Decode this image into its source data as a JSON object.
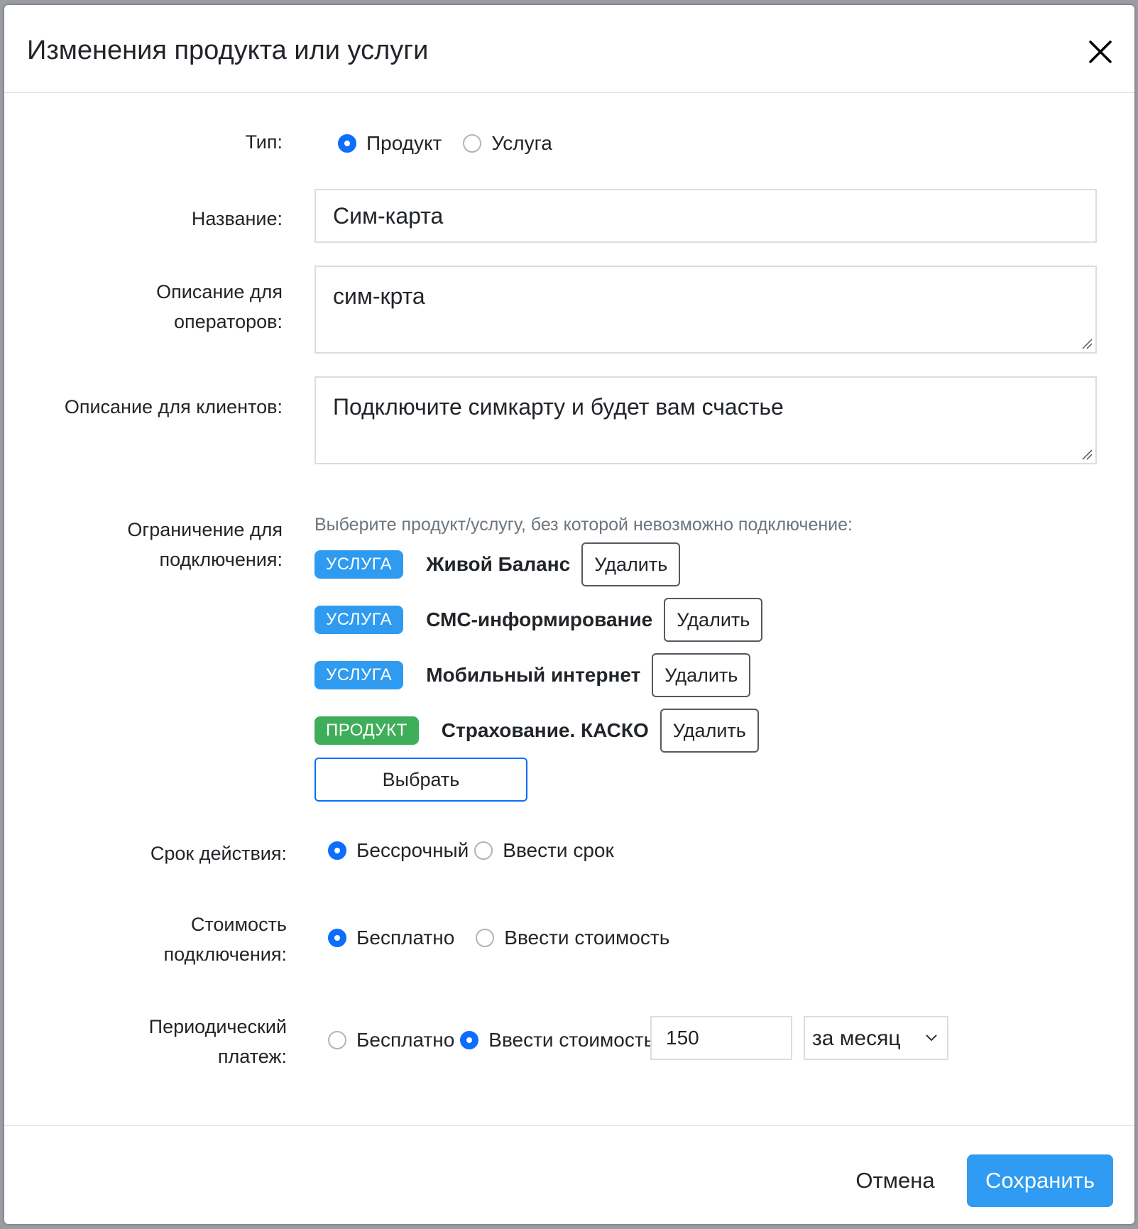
{
  "modal": {
    "title": "Изменения продукта или услуги"
  },
  "form": {
    "type": {
      "label": "Тип:",
      "options": [
        "Продукт",
        "Услуга"
      ],
      "selected": "Продукт"
    },
    "name": {
      "label": "Название:",
      "value": "Сим-карта"
    },
    "operator_description": {
      "label_line1": "Описание для",
      "label_line2": "операторов:",
      "value": "сим-крта"
    },
    "client_description": {
      "label": "Описание для клиентов:",
      "value": "Подключите симкарту и будет вам счастье"
    },
    "restriction": {
      "label_line1": "Ограничение для",
      "label_line2": "подключения:",
      "hint": "Выберите продукт/услугу, без которой невозможно подключение:",
      "items": [
        {
          "badge": "УСЛУГА",
          "kind": "service",
          "name": "Живой Баланс",
          "remove_label": "Удалить"
        },
        {
          "badge": "УСЛУГА",
          "kind": "service",
          "name": "СМС-информирование",
          "remove_label": "Удалить"
        },
        {
          "badge": "УСЛУГА",
          "kind": "service",
          "name": "Мобильный интернет",
          "remove_label": "Удалить"
        },
        {
          "badge": "ПРОДУКТ",
          "kind": "product",
          "name": "Страхование. КАСКО",
          "remove_label": "Удалить"
        }
      ],
      "choose_label": "Выбрать"
    },
    "validity": {
      "label": "Срок действия:",
      "options": [
        "Бессрочный",
        "Ввести срок"
      ],
      "selected": "Бессрочный"
    },
    "connection_cost": {
      "label_line1": "Стоимость",
      "label_line2": "подключения:",
      "options": [
        "Бесплатно",
        "Ввести стоимость"
      ],
      "selected": "Бесплатно"
    },
    "periodic_payment": {
      "label_line1": "Периодический",
      "label_line2": "платеж:",
      "options": [
        "Бесплатно",
        "Ввести стоимость"
      ],
      "selected": "Ввести стоимость",
      "amount": "150",
      "period": "за месяц"
    }
  },
  "footer": {
    "cancel_label": "Отмена",
    "save_label": "Сохранить"
  },
  "colors": {
    "primary": "#0d6efd",
    "save_button": "#2f9bf2",
    "service_badge": "#2e9bf0",
    "product_badge": "#3fae5a"
  }
}
